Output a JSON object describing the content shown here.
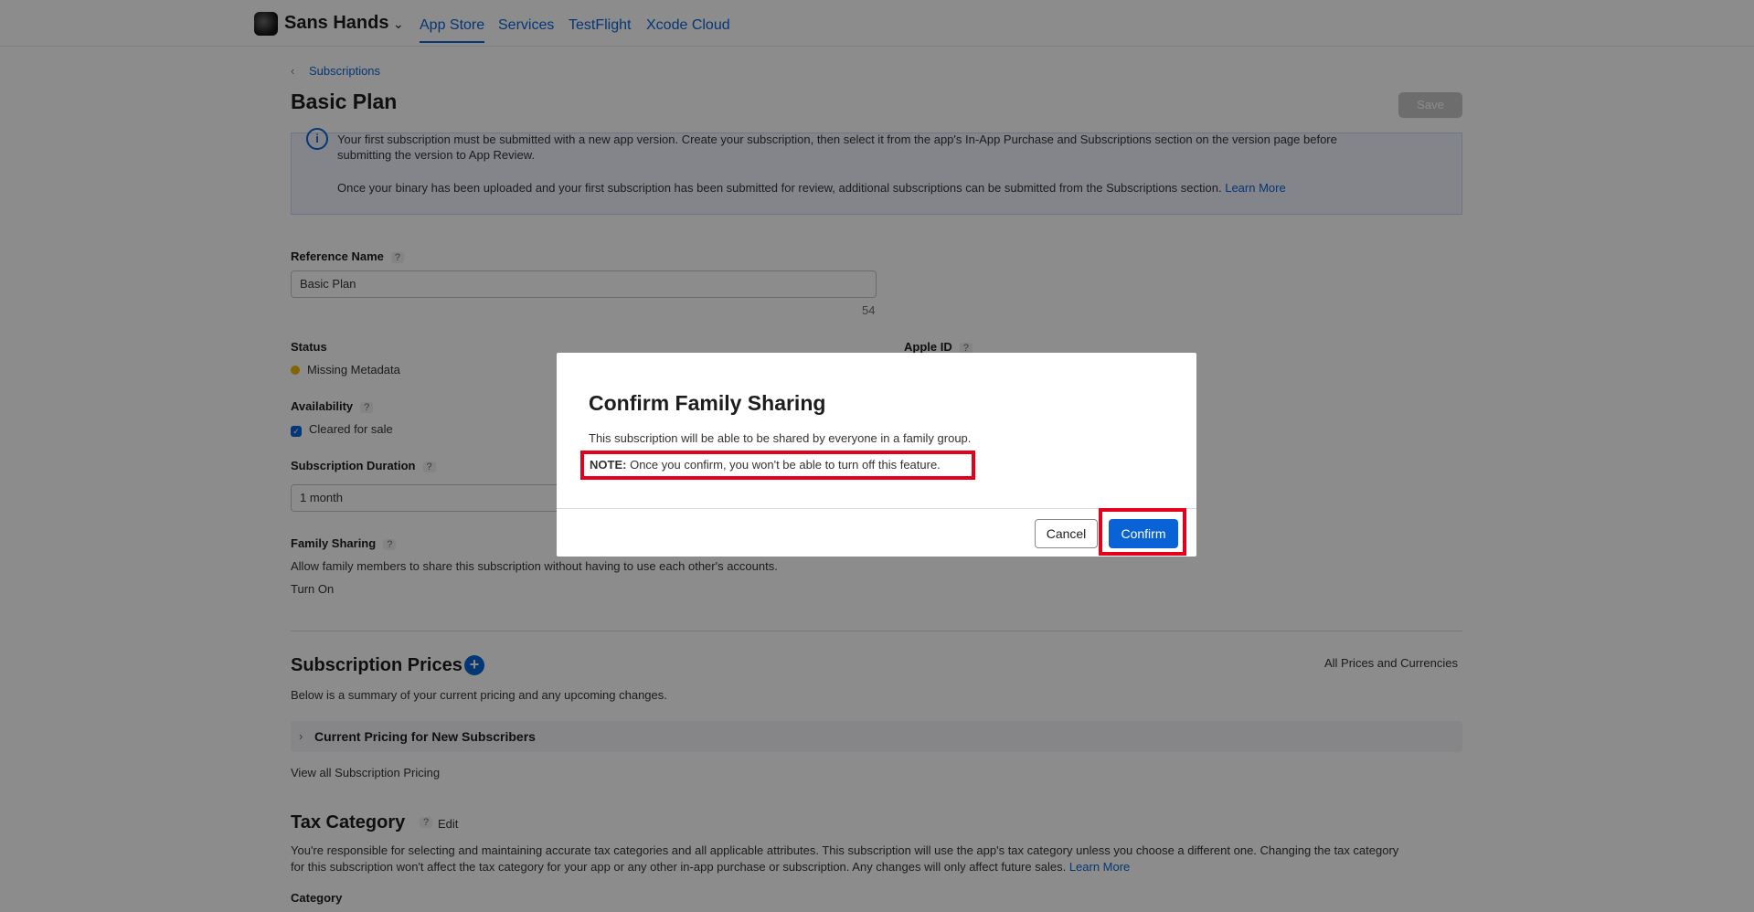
{
  "topnav": {
    "app_name": "Sans Hands",
    "tabs": [
      "App Store",
      "Services",
      "TestFlight",
      "Xcode Cloud"
    ]
  },
  "page": {
    "breadcrumb": "Subscriptions",
    "title": "Basic Plan",
    "save_label": "Save",
    "info": {
      "line1": "Your first subscription must be submitted with a new app version. Create your subscription, then select it from the app's In-App Purchase and Subscriptions section on the version page before",
      "line2": "submitting the version to App Review.",
      "line3": "Once your binary has been uploaded and your first subscription has been submitted for review, additional subscriptions can be submitted from the Subscriptions section.",
      "learn_more": "Learn More"
    },
    "reference_name": {
      "label": "Reference Name",
      "help": "?",
      "value": "Basic Plan",
      "count": "54"
    },
    "apple_id": {
      "label": "Apple ID",
      "help": "?"
    },
    "status": {
      "label": "Status",
      "value": "Missing Metadata"
    },
    "availability": {
      "label": "Availability",
      "help": "?",
      "value": "Cleared for sale"
    },
    "duration": {
      "label": "Subscription Duration",
      "help": "?",
      "value": "1 month"
    },
    "family_sharing": {
      "label": "Family Sharing",
      "help": "?",
      "desc": "Allow family members to share this subscription without having to use each other's accounts.",
      "action": "Turn On"
    },
    "prices": {
      "title": "Subscription Prices",
      "all_link": "All Prices and Currencies",
      "desc": "Below is a summary of your current pricing and any upcoming changes.",
      "accordion": "Current Pricing for New Subscribers",
      "view_all": "View all Subscription Pricing"
    },
    "tax": {
      "title": "Tax Category",
      "help": "?",
      "edit": "Edit",
      "line1": "You're responsible for selecting and maintaining accurate tax categories and all applicable attributes. This subscription will use the app's tax category unless you choose a different one. Changing the tax category",
      "line2": "for this subscription won't affect the tax category for your app or any other in-app purchase or subscription. Any changes will only affect future sales.",
      "learn_more": "Learn More",
      "category_label": "Category"
    }
  },
  "modal": {
    "title": "Confirm Family Sharing",
    "desc": "This subscription will be able to be shared by everyone in a family group.",
    "note_label": "NOTE:",
    "note_text": "Once you confirm, you won't be able to turn off this feature.",
    "cancel": "Cancel",
    "confirm": "Confirm"
  },
  "colors": {
    "accent": "#0a63d6",
    "highlight": "#e3001b",
    "status": "#f0b400"
  }
}
